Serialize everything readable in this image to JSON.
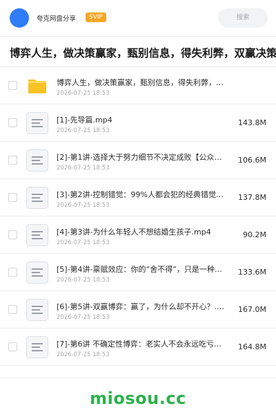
{
  "header": {
    "brand": "夸克网盘分享",
    "badge": "SVIP",
    "search_label": "搜索"
  },
  "share": {
    "title": "博弈人生，做决策赢家，甄别信息，得失利弊，双赢决策，"
  },
  "files": [
    {
      "type": "folder",
      "icon": "folder-icon",
      "name": "博弈人生，做决策赢家，甄别信息，得失利弊，双赢决策…",
      "date": "2026-07-25 18:53",
      "size": ""
    },
    {
      "type": "file",
      "icon": "document-icon",
      "name": "[1]-先导篇.mp4",
      "date": "2026-07-25 18:53",
      "size": "143.8M"
    },
    {
      "type": "file",
      "icon": "document-icon",
      "name": "[2]-第1讲-选择大于努力细节不决定成败【公众号…",
      "date": "2026-07-25 18:53",
      "size": "106.6M"
    },
    {
      "type": "file",
      "icon": "document-icon",
      "name": "[3]-第2讲-控制错觉：99%人都会犯的经典错觉…",
      "date": "2026-07-25 18:53",
      "size": "137.8M"
    },
    {
      "type": "file",
      "icon": "document-icon",
      "name": "[4]-第3讲-为什么年轻人不想结婚生孩子.mp4",
      "date": "2026-07-25 18:53",
      "size": "90.2M"
    },
    {
      "type": "file",
      "icon": "document-icon",
      "name": "[5]-第4讲-禀赋效应：你的“舍不得”，只是一种…",
      "date": "2026-07-25 18:53",
      "size": "133.6M"
    },
    {
      "type": "file",
      "icon": "document-icon",
      "name": "[6]-第5讲-双赢博弈：赢了，为什么却不开心？.…",
      "date": "2026-07-25 18:53",
      "size": "167.0M"
    },
    {
      "type": "file",
      "icon": "document-icon",
      "name": "[7]-第6讲 不确定性博弈：老实人不会永远吃亏【…",
      "date": "2026-07-25 18:53",
      "size": "164.8M"
    }
  ],
  "watermark": "miosou.cc",
  "colors": {
    "avatar": "#2f7cf6",
    "badge": "#f5a623",
    "folder": "#f7c325",
    "watermark": "#2bb24c"
  }
}
